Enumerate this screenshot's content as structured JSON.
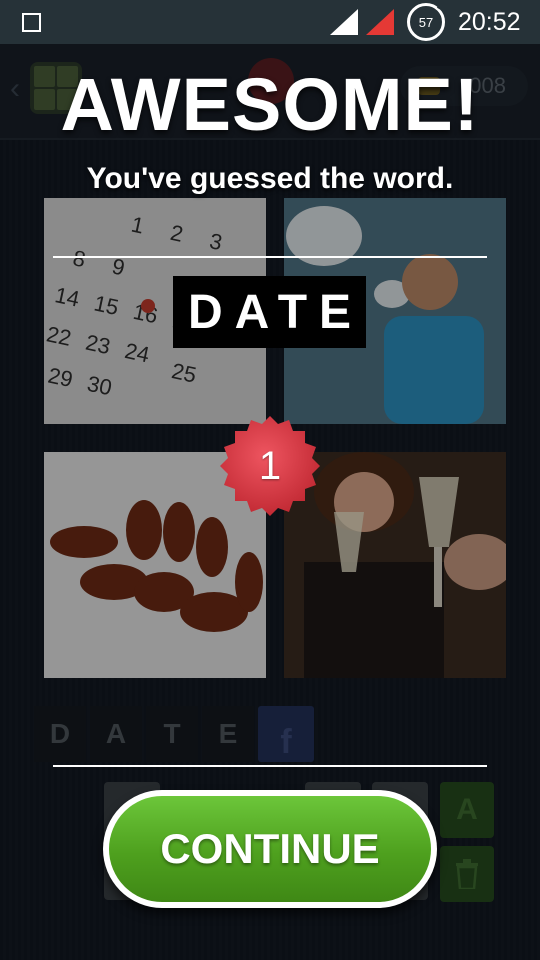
{
  "status_bar": {
    "battery_level": "57",
    "time": "20:52"
  },
  "game": {
    "coins": "008",
    "answer_letters": [
      "D",
      "A",
      "T",
      "E"
    ],
    "share_label": "f",
    "hint_icon": "A",
    "icons": {
      "back": "chevron-left-icon",
      "hint": "magic-letter-icon",
      "delete": "trash-icon",
      "share": "facebook-icon"
    }
  },
  "overlay": {
    "title": "AWESOME!",
    "subtitle": "You've guessed the word.",
    "solved_word": "DATE",
    "level": "1",
    "continue_label": "CONTINUE"
  },
  "colors": {
    "continue_green": "#4ea01e",
    "badge_red": "#d2343e",
    "status_bar": "#263238"
  }
}
